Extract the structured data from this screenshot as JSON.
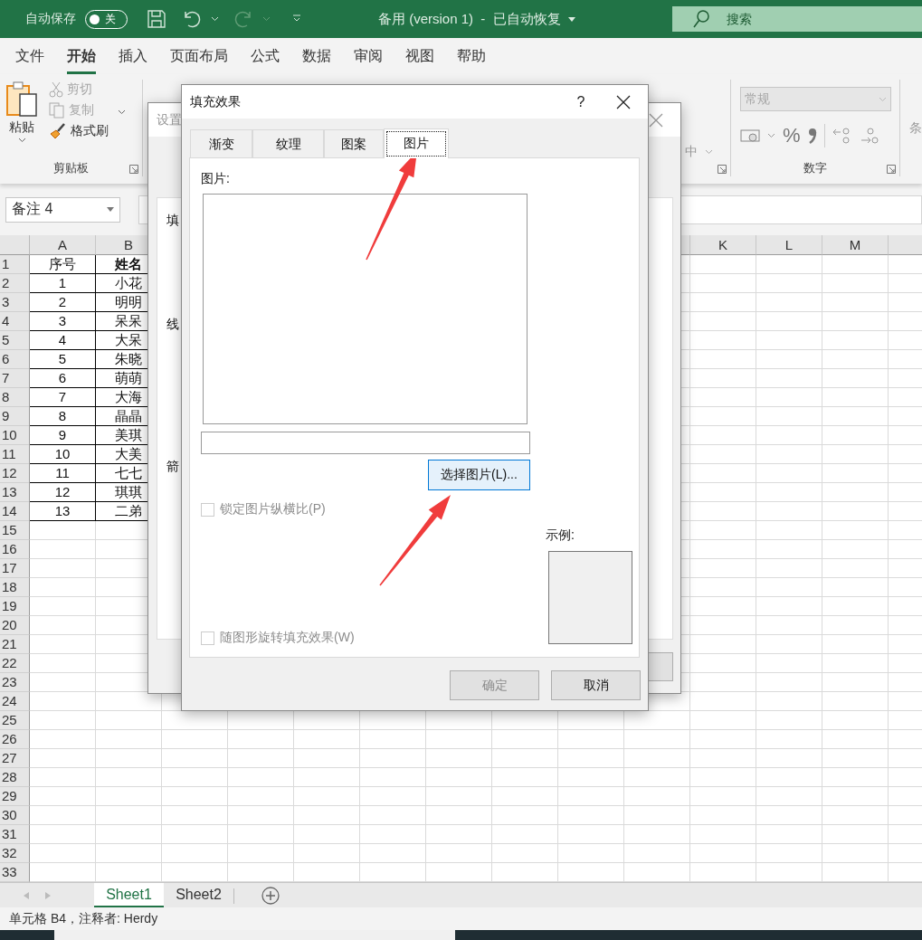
{
  "app": {
    "autosave_label": "自动保存",
    "autosave_toggle": {
      "label": "关",
      "on": false
    },
    "title": "备用 (version 1)  -  已自动恢复",
    "search": {
      "placeholder": "搜索"
    }
  },
  "menu_tabs": [
    {
      "label": "文件",
      "selected": false
    },
    {
      "label": "开始",
      "selected": true
    },
    {
      "label": "插入",
      "selected": false
    },
    {
      "label": "页面布局",
      "selected": false
    },
    {
      "label": "公式",
      "selected": false
    },
    {
      "label": "数据",
      "selected": false
    },
    {
      "label": "审阅",
      "selected": false
    },
    {
      "label": "视图",
      "selected": false
    },
    {
      "label": "帮助",
      "selected": false
    }
  ],
  "ribbon": {
    "paste": "粘贴",
    "clipboard_items": [
      {
        "label": "剪切",
        "disabled": true
      },
      {
        "label": "复制",
        "disabled": true
      },
      {
        "label": "格式刷",
        "disabled": false
      }
    ],
    "clipboard_label": "剪贴板",
    "alignment_fragment": "中",
    "number_format": "常规",
    "percent": "%",
    "number_label": "数字",
    "next_group_fragment": "条"
  },
  "name_box": "备注 4",
  "sheet": {
    "column_headers": [
      "A",
      "B",
      "K",
      "L",
      "M"
    ],
    "row_numbers": [
      "1",
      "2",
      "3",
      "4",
      "5",
      "6",
      "7",
      "8",
      "9",
      "10",
      "11",
      "12",
      "13",
      "14",
      "15",
      "16",
      "17",
      "18",
      "19",
      "20",
      "21",
      "22",
      "23",
      "24",
      "25",
      "26",
      "27",
      "28",
      "29",
      "30",
      "31",
      "32",
      "33"
    ],
    "header_row": [
      {
        "text": "序号",
        "bold": false
      },
      {
        "text": "姓名",
        "bold": true
      }
    ],
    "rows": [
      [
        "1",
        "小花"
      ],
      [
        "2",
        "明明"
      ],
      [
        "3",
        "呆呆"
      ],
      [
        "4",
        "大呆"
      ],
      [
        "5",
        "朱晓"
      ],
      [
        "6",
        "萌萌"
      ],
      [
        "7",
        "大海"
      ],
      [
        "8",
        "晶晶"
      ],
      [
        "9",
        "美琪"
      ],
      [
        "10",
        "大美"
      ],
      [
        "11",
        "七七"
      ],
      [
        "12",
        "琪琪"
      ],
      [
        "13",
        "二弟"
      ]
    ]
  },
  "back_dialog": {
    "title": "设置",
    "section_labels": [
      "填",
      "线",
      "箭"
    ]
  },
  "fill_dialog": {
    "title": "填充效果",
    "help": "?",
    "tabs": [
      {
        "label": "渐变",
        "selected": false
      },
      {
        "label": "纹理",
        "selected": false
      },
      {
        "label": "图案",
        "selected": false
      },
      {
        "label": "图片",
        "selected": true
      }
    ],
    "picture_label": "图片:",
    "select_button": "选择图片(L)...",
    "checkboxes": [
      {
        "label": "锁定图片纵横比(P)",
        "checked": false,
        "disabled": true
      },
      {
        "label": "随图形旋转填充效果(W)",
        "checked": false,
        "disabled": true
      }
    ],
    "sample_label": "示例:",
    "buttons": [
      {
        "label": "确定",
        "disabled": true
      },
      {
        "label": "取消",
        "disabled": false
      }
    ]
  },
  "sheet_tabs": [
    {
      "label": "Sheet1",
      "selected": true
    },
    {
      "label": "Sheet2",
      "selected": false
    }
  ],
  "status_bar": "单元格 B4，注释者: Herdy"
}
